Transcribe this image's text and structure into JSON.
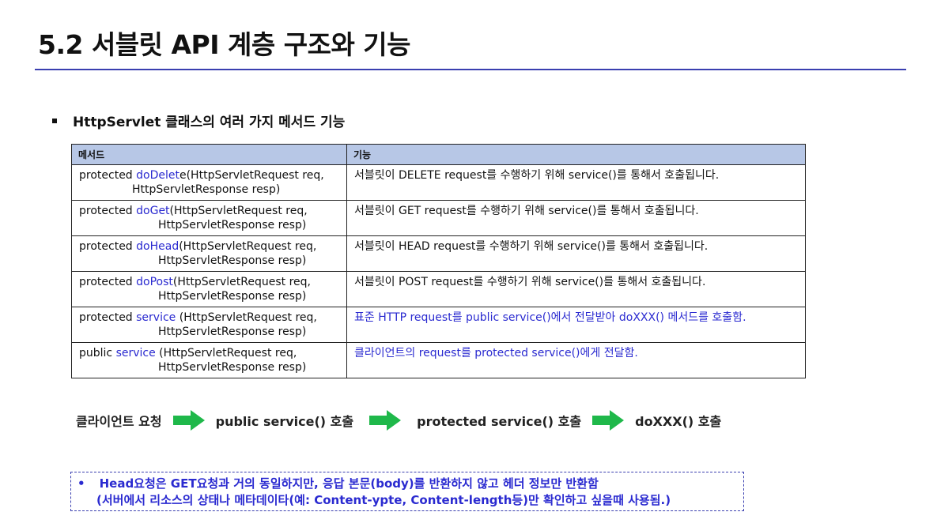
{
  "slide": {
    "title": "5.2 서블릿 API 계층 구조와 기능",
    "subtitle": "HttpServlet 클래스의 여러 가지 메서드 기능",
    "table": {
      "headers": [
        "메서드",
        "기능"
      ],
      "rows": [
        {
          "prefix": "protected ",
          "method": "doDelet",
          "rest": "e(HttpServletRequest req,",
          "line2": "HttpServletResponse resp)",
          "desc": "서블릿이 DELETE request를 수행하기 위해 service()를 통해서 호출됩니다.",
          "desc_blue": false
        },
        {
          "prefix": "protected ",
          "method": "doGet",
          "rest": "(HttpServletRequest req,",
          "line2": "HttpServletResponse resp)",
          "desc": "서블릿이 GET request를 수행하기 위해 service()를 통해서 호출됩니다.",
          "desc_blue": false
        },
        {
          "prefix": "protected ",
          "method": "doHead",
          "rest": "(HttpServletRequest req,",
          "line2": "HttpServletResponse resp)",
          "desc": "서블릿이 HEAD request를 수행하기 위해 service()를 통해서 호출됩니다.",
          "desc_blue": false
        },
        {
          "prefix": "protected ",
          "method": "doPost",
          "rest": "(HttpServletRequest req,",
          "line2": "HttpServletResponse resp)",
          "desc": "서블릿이 POST request를 수행하기 위해 service()를 통해서 호출됩니다.",
          "desc_blue": false
        },
        {
          "prefix": "protected ",
          "method": "service",
          "rest": " (HttpServletRequest req,",
          "line2": "HttpServletResponse resp)",
          "desc": "표준 HTTP request를 public service()에서 전달받아 doXXX() 메서드를 호출함.",
          "desc_blue": true
        },
        {
          "prefix": "public ",
          "method": "service",
          "rest": " (HttpServletRequest req,",
          "line2": "HttpServletResponse resp)",
          "desc": "클라이언트의 request를 protected service()에게 전달함.",
          "desc_blue": true
        }
      ]
    },
    "flow": [
      "클라이언트 요청",
      "public service() 호출",
      "protected service()  호출",
      "doXXX() 호출"
    ],
    "note": {
      "bullet": "•",
      "line1": "Head요청은 GET요청과 거의 동일하지만, 응답 본문(body)를 반환하지 않고 헤더 정보만 반환함",
      "line2": "(서버에서 리소스의 상태나 메타데이타(예: Content-ypte, Content-length등)만 확인하고 싶을때 사용됨.)"
    },
    "colors": {
      "accent": "#3a3fb0",
      "header_bg": "#b7c7e6",
      "arrow": "#1fb84a",
      "highlight": "#2a2ad0"
    }
  }
}
